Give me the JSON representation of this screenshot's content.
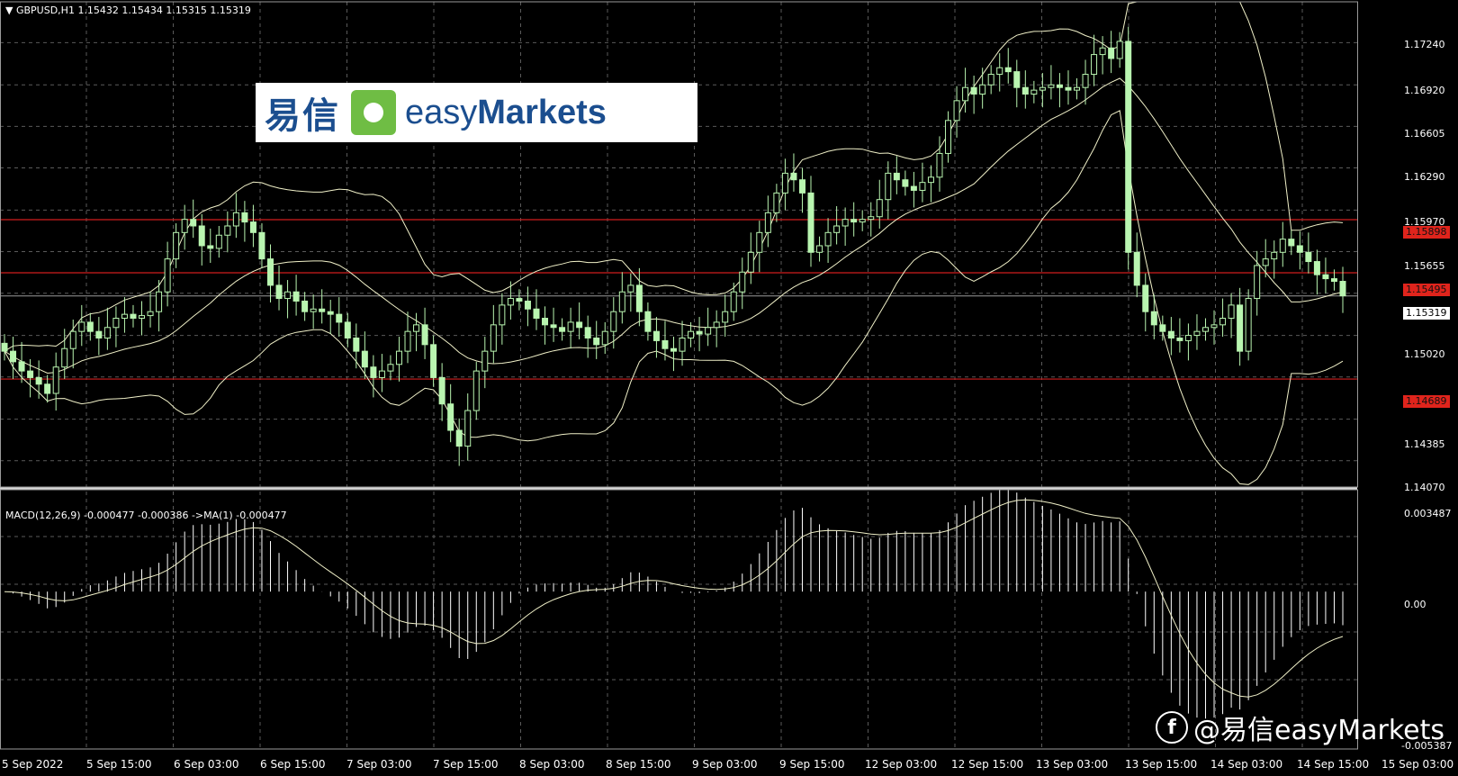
{
  "header": {
    "symbol_info": "GBPUSD,H1  1.15432 1.15434 1.15315 1.15319",
    "macd_info": "MACD(12,26,9) -0.000477 -0.000386  ->MA(1) -0.000477"
  },
  "price_axis": {
    "labels": [
      "1.17240",
      "1.16920",
      "1.16605",
      "1.16290",
      "1.15970",
      "1.15655",
      "1.15020",
      "1.14385",
      "1.14070"
    ]
  },
  "price_tags": {
    "resistance": "1.15898",
    "mid": "1.15495",
    "current": "1.15319",
    "support": "1.14689"
  },
  "macd_axis": {
    "top": "0.003487",
    "zero": "0.00",
    "bottom": "-0.005387"
  },
  "time_axis": {
    "labels": [
      "5 Sep 2022",
      "5 Sep 15:00",
      "6 Sep 03:00",
      "6 Sep 15:00",
      "7 Sep 03:00",
      "7 Sep 15:00",
      "8 Sep 03:00",
      "8 Sep 15:00",
      "9 Sep 03:00",
      "9 Sep 15:00",
      "12 Sep 03:00",
      "12 Sep 15:00",
      "13 Sep 03:00",
      "13 Sep 15:00",
      "14 Sep 03:00",
      "14 Sep 15:00",
      "15 Sep 03:00"
    ]
  },
  "logo": {
    "cn": "易信",
    "en_light": "easy",
    "en_bold": "Markets"
  },
  "watermark": {
    "text": "@易信easyMarkets",
    "icon": "facebook-icon"
  },
  "colors": {
    "background": "#000000",
    "grid": "#5a5a5a",
    "candle": "#b9f5b0",
    "bands": "#f0f0c8",
    "level_line": "#d01c1c",
    "tag_red": "#e0241c",
    "macd_hist": "#ffffff",
    "macd_signal": "#f0f0c8"
  },
  "chart_data": {
    "type": "line",
    "title": "GBPUSD,H1",
    "instrument": "GBPUSD",
    "timeframe": "H1",
    "last_bar": {
      "open": 1.15432,
      "high": 1.15434,
      "low": 1.15315,
      "close": 1.15319
    },
    "horizontal_levels": [
      1.15898,
      1.15495,
      1.14689
    ],
    "x_ticks": [
      "5 Sep 2022",
      "5 Sep 15:00",
      "6 Sep 03:00",
      "6 Sep 15:00",
      "7 Sep 03:00",
      "7 Sep 15:00",
      "8 Sep 03:00",
      "8 Sep 15:00",
      "9 Sep 03:00",
      "9 Sep 15:00",
      "12 Sep 03:00",
      "12 Sep 15:00",
      "13 Sep 03:00",
      "13 Sep 15:00",
      "14 Sep 03:00",
      "14 Sep 15:00",
      "15 Sep 03:00"
    ],
    "y_range": [
      1.1387,
      1.1755
    ],
    "close_series": [
      [
        0,
        1.149
      ],
      [
        1,
        1.1482
      ],
      [
        2,
        1.1475
      ],
      [
        3,
        1.147
      ],
      [
        4,
        1.1465
      ],
      [
        5,
        1.1458
      ],
      [
        6,
        1.1478
      ],
      [
        7,
        1.1492
      ],
      [
        8,
        1.1505
      ],
      [
        9,
        1.1512
      ],
      [
        10,
        1.1505
      ],
      [
        11,
        1.15
      ],
      [
        12,
        1.1508
      ],
      [
        13,
        1.1515
      ],
      [
        14,
        1.1518
      ],
      [
        15,
        1.1515
      ],
      [
        16,
        1.1517
      ],
      [
        17,
        1.152
      ],
      [
        18,
        1.1535
      ],
      [
        19,
        1.156
      ],
      [
        20,
        1.158
      ],
      [
        21,
        1.159
      ],
      [
        22,
        1.1585
      ],
      [
        23,
        1.157
      ],
      [
        24,
        1.1568
      ],
      [
        25,
        1.1578
      ],
      [
        26,
        1.1585
      ],
      [
        27,
        1.1595
      ],
      [
        28,
        1.1588
      ],
      [
        29,
        1.158
      ],
      [
        30,
        1.156
      ],
      [
        31,
        1.154
      ],
      [
        32,
        1.153
      ],
      [
        33,
        1.1535
      ],
      [
        34,
        1.1528
      ],
      [
        35,
        1.152
      ],
      [
        36,
        1.1522
      ],
      [
        37,
        1.152
      ],
      [
        38,
        1.1518
      ],
      [
        39,
        1.1512
      ],
      [
        40,
        1.15
      ],
      [
        41,
        1.149
      ],
      [
        42,
        1.1478
      ],
      [
        43,
        1.147
      ],
      [
        44,
        1.1475
      ],
      [
        45,
        1.148
      ],
      [
        46,
        1.149
      ],
      [
        47,
        1.1505
      ],
      [
        48,
        1.151
      ],
      [
        49,
        1.1495
      ],
      [
        50,
        1.147
      ],
      [
        51,
        1.145
      ],
      [
        52,
        1.143
      ],
      [
        53,
        1.1418
      ],
      [
        54,
        1.1445
      ],
      [
        55,
        1.1475
      ],
      [
        56,
        1.149
      ],
      [
        57,
        1.151
      ],
      [
        58,
        1.1525
      ],
      [
        59,
        1.153
      ],
      [
        60,
        1.1528
      ],
      [
        61,
        1.1522
      ],
      [
        62,
        1.1515
      ],
      [
        63,
        1.151
      ],
      [
        64,
        1.1508
      ],
      [
        65,
        1.1505
      ],
      [
        66,
        1.1512
      ],
      [
        67,
        1.1508
      ],
      [
        68,
        1.15
      ],
      [
        69,
        1.1495
      ],
      [
        70,
        1.1505
      ],
      [
        71,
        1.152
      ],
      [
        72,
        1.1535
      ],
      [
        73,
        1.154
      ],
      [
        74,
        1.152
      ],
      [
        75,
        1.1505
      ],
      [
        76,
        1.1498
      ],
      [
        77,
        1.1492
      ],
      [
        78,
        1.149
      ],
      [
        79,
        1.15
      ],
      [
        80,
        1.1505
      ],
      [
        81,
        1.1503
      ],
      [
        82,
        1.1508
      ],
      [
        83,
        1.1512
      ],
      [
        84,
        1.152
      ],
      [
        85,
        1.1535
      ],
      [
        86,
        1.155
      ],
      [
        87,
        1.1565
      ],
      [
        88,
        1.158
      ],
      [
        89,
        1.1595
      ],
      [
        90,
        1.161
      ],
      [
        91,
        1.1625
      ],
      [
        92,
        1.162
      ],
      [
        93,
        1.161
      ],
      [
        94,
        1.1565
      ],
      [
        95,
        1.157
      ],
      [
        96,
        1.158
      ],
      [
        97,
        1.1585
      ],
      [
        98,
        1.159
      ],
      [
        99,
        1.1588
      ],
      [
        100,
        1.159
      ],
      [
        101,
        1.1592
      ],
      [
        102,
        1.1605
      ],
      [
        103,
        1.1625
      ],
      [
        104,
        1.162
      ],
      [
        105,
        1.1615
      ],
      [
        106,
        1.1612
      ],
      [
        107,
        1.1618
      ],
      [
        108,
        1.1622
      ],
      [
        109,
        1.164
      ],
      [
        110,
        1.1665
      ],
      [
        111,
        1.168
      ],
      [
        112,
        1.169
      ],
      [
        113,
        1.1685
      ],
      [
        114,
        1.1692
      ],
      [
        115,
        1.17
      ],
      [
        116,
        1.1705
      ],
      [
        117,
        1.1702
      ],
      [
        118,
        1.169
      ],
      [
        119,
        1.1685
      ],
      [
        120,
        1.1688
      ],
      [
        121,
        1.169
      ],
      [
        122,
        1.1692
      ],
      [
        123,
        1.169
      ],
      [
        124,
        1.1688
      ],
      [
        125,
        1.169
      ],
      [
        126,
        1.17
      ],
      [
        127,
        1.1715
      ],
      [
        128,
        1.172
      ],
      [
        129,
        1.1712
      ],
      [
        130,
        1.1725
      ],
      [
        131,
        1.1565
      ],
      [
        132,
        1.154
      ],
      [
        133,
        1.152
      ],
      [
        134,
        1.151
      ],
      [
        135,
        1.1505
      ],
      [
        136,
        1.15
      ],
      [
        137,
        1.1498
      ],
      [
        138,
        1.1502
      ],
      [
        139,
        1.1505
      ],
      [
        140,
        1.1508
      ],
      [
        141,
        1.151
      ],
      [
        142,
        1.1515
      ],
      [
        143,
        1.1525
      ],
      [
        144,
        1.149
      ],
      [
        145,
        1.153
      ],
      [
        146,
        1.1555
      ],
      [
        147,
        1.156
      ],
      [
        148,
        1.1565
      ],
      [
        149,
        1.1575
      ],
      [
        150,
        1.157
      ],
      [
        151,
        1.1565
      ],
      [
        152,
        1.1558
      ],
      [
        153,
        1.1548
      ],
      [
        154,
        1.1545
      ],
      [
        155,
        1.1543
      ],
      [
        156,
        1.1532
      ]
    ],
    "indicators": [
      "Bollinger Bands",
      "MACD(12,26,9)"
    ],
    "macd": {
      "label": "MACD(12,26,9)",
      "main": -0.000477,
      "signal": -0.000386,
      "ylim": [
        -0.005387,
        0.003487
      ]
    }
  }
}
